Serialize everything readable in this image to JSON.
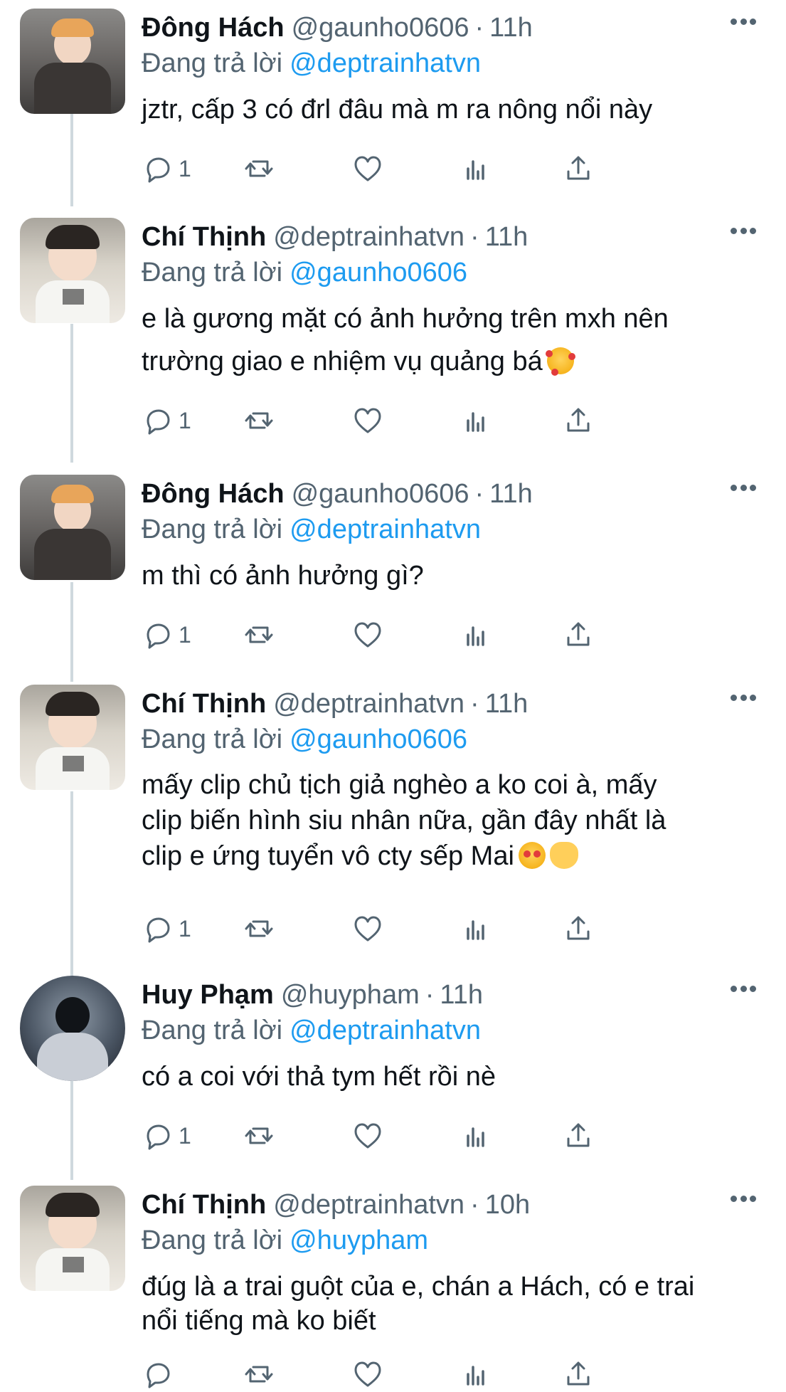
{
  "tweets": [
    {
      "name": "Đông Hách",
      "handle": "@gaunho0606",
      "time": "11h",
      "replying_label": "Đang trả lời",
      "reply_to": "@deptrainhatvn",
      "lines": [
        "jztr, cấp 3 có đrl đâu mà m ra nông nổi này"
      ],
      "reply_count": "1",
      "avatar": "dong-hach-avatar"
    },
    {
      "name": "Chí Thịnh",
      "handle": "@deptrainhatvn",
      "time": "11h",
      "replying_label": "Đang trả lời",
      "reply_to": "@gaunho0606",
      "lines": [
        "e là gương mặt có ảnh hưởng trên mxh nên",
        "trường giao e nhiệm vụ quảng bá"
      ],
      "emoji": "smiling-face-with-hearts",
      "reply_count": "1",
      "avatar": "chi-thinh-avatar"
    },
    {
      "name": "Đông Hách",
      "handle": "@gaunho0606",
      "time": "11h",
      "replying_label": "Đang trả lời",
      "reply_to": "@deptrainhatvn",
      "lines": [
        "m thì có ảnh hưởng gì?"
      ],
      "reply_count": "1",
      "avatar": "dong-hach-avatar"
    },
    {
      "name": "Chí Thịnh",
      "handle": "@deptrainhatvn",
      "time": "11h",
      "replying_label": "Đang trả lời",
      "reply_to": "@gaunho0606",
      "lines": [
        "mấy clip chủ tịch giả nghèo a ko coi à, mấy",
        "clip biến hình siu nhân nữa, gần đây nhất là",
        "clip e ứng tuyển vô cty sếp Mai"
      ],
      "emoji": "heart-eyes-and-heart-hands",
      "reply_count": "1",
      "avatar": "chi-thinh-avatar"
    },
    {
      "name": "Huy Phạm",
      "handle": "@huypham",
      "time": "11h",
      "replying_label": "Đang trả lời",
      "reply_to": "@deptrainhatvn",
      "lines": [
        "có a coi với thả tym hết rồi nè"
      ],
      "reply_count": "1",
      "avatar": "huy-pham-avatar"
    },
    {
      "name": "Chí Thịnh",
      "handle": "@deptrainhatvn",
      "time": "10h",
      "replying_label": "Đang trả lời",
      "reply_to": "@huypham",
      "lines": [
        "đúg là a trai guột của e, chán a Hách, có e trai",
        "nổi tiếng mà ko biết"
      ],
      "reply_count": "",
      "avatar": "chi-thinh-avatar"
    }
  ],
  "colors": {
    "text": "#0f1419",
    "secondary": "#536471",
    "mention": "#1d9bf0",
    "thread_line": "#cfd9de"
  },
  "action_icons": [
    "reply-icon",
    "retweet-icon",
    "like-icon",
    "analytics-icon",
    "share-icon"
  ]
}
